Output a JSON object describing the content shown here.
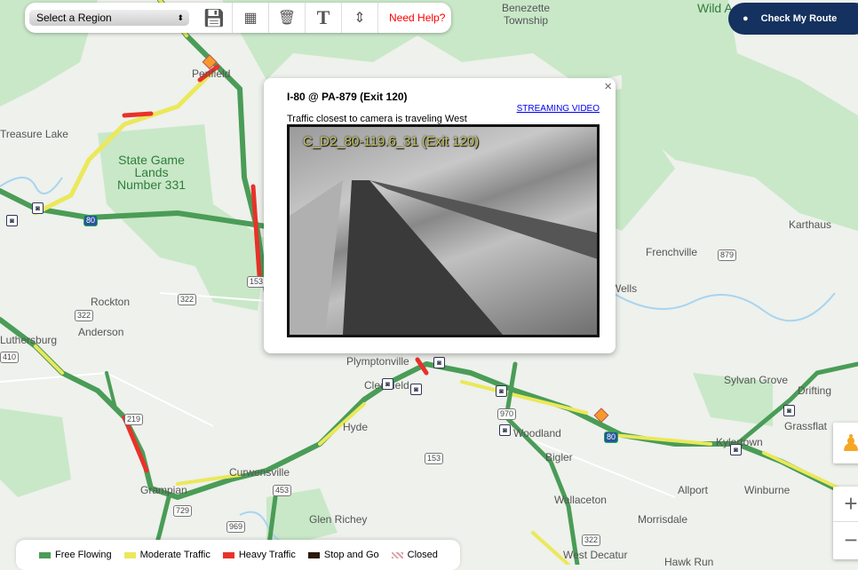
{
  "toolbar": {
    "region_select": "Select a Region",
    "tools": [
      {
        "icon": "save-icon"
      },
      {
        "icon": "map-icon"
      },
      {
        "icon": "trash-icon"
      },
      {
        "icon": "text-icon"
      },
      {
        "icon": "resize-icon"
      }
    ],
    "help": "Need Help?"
  },
  "route_button": {
    "label": "Check My Route",
    "icon": "location-pin-icon"
  },
  "popup": {
    "title": "I-80 @ PA-879 (Exit 120)",
    "streaming": "STREAMING VIDEO",
    "direction": "Traffic closest to camera is traveling West",
    "camera_caption": "C_D2_80-119.6_31 (Exit 120)"
  },
  "legend": [
    {
      "label": "Free Flowing",
      "color": "#4a9c57"
    },
    {
      "label": "Moderate Traffic",
      "color": "#ebe85a"
    },
    {
      "label": "Heavy Traffic",
      "color": "#e8322a"
    },
    {
      "label": "Stop and Go",
      "color": "#2a1a06"
    },
    {
      "label": "Closed",
      "color": "#d9a0a8"
    }
  ],
  "map": {
    "labels": [
      "Benezette\nTownship",
      "Wild A",
      "Treasure Lake",
      "Penfield",
      "State Game\nLands\nNumber 331",
      "Rockton",
      "Anderson",
      "Luthersburg",
      "Frenchville",
      "Karthaus",
      "Sylvan Grove",
      "Drifting",
      "Grassflat",
      "Kylertown",
      "Winburne",
      "Allport",
      "Morrisdale",
      "Bigler",
      "Woodland",
      "Wallaceton",
      "Clearfield",
      "Hyde",
      "Curwensville",
      "Grampian",
      "Glen Richey",
      "West Decatur",
      "Hawk Run",
      "Plymptonville",
      "Wells"
    ],
    "shields": [
      "322",
      "322",
      "410",
      "153",
      "153",
      "879",
      "219",
      "729",
      "969",
      "453",
      "970",
      "322",
      "80",
      "80"
    ]
  },
  "colors": {
    "free": "#4a9c57",
    "moderate": "#ebe85a",
    "heavy": "#e8322a",
    "route_button": "#14315f"
  }
}
